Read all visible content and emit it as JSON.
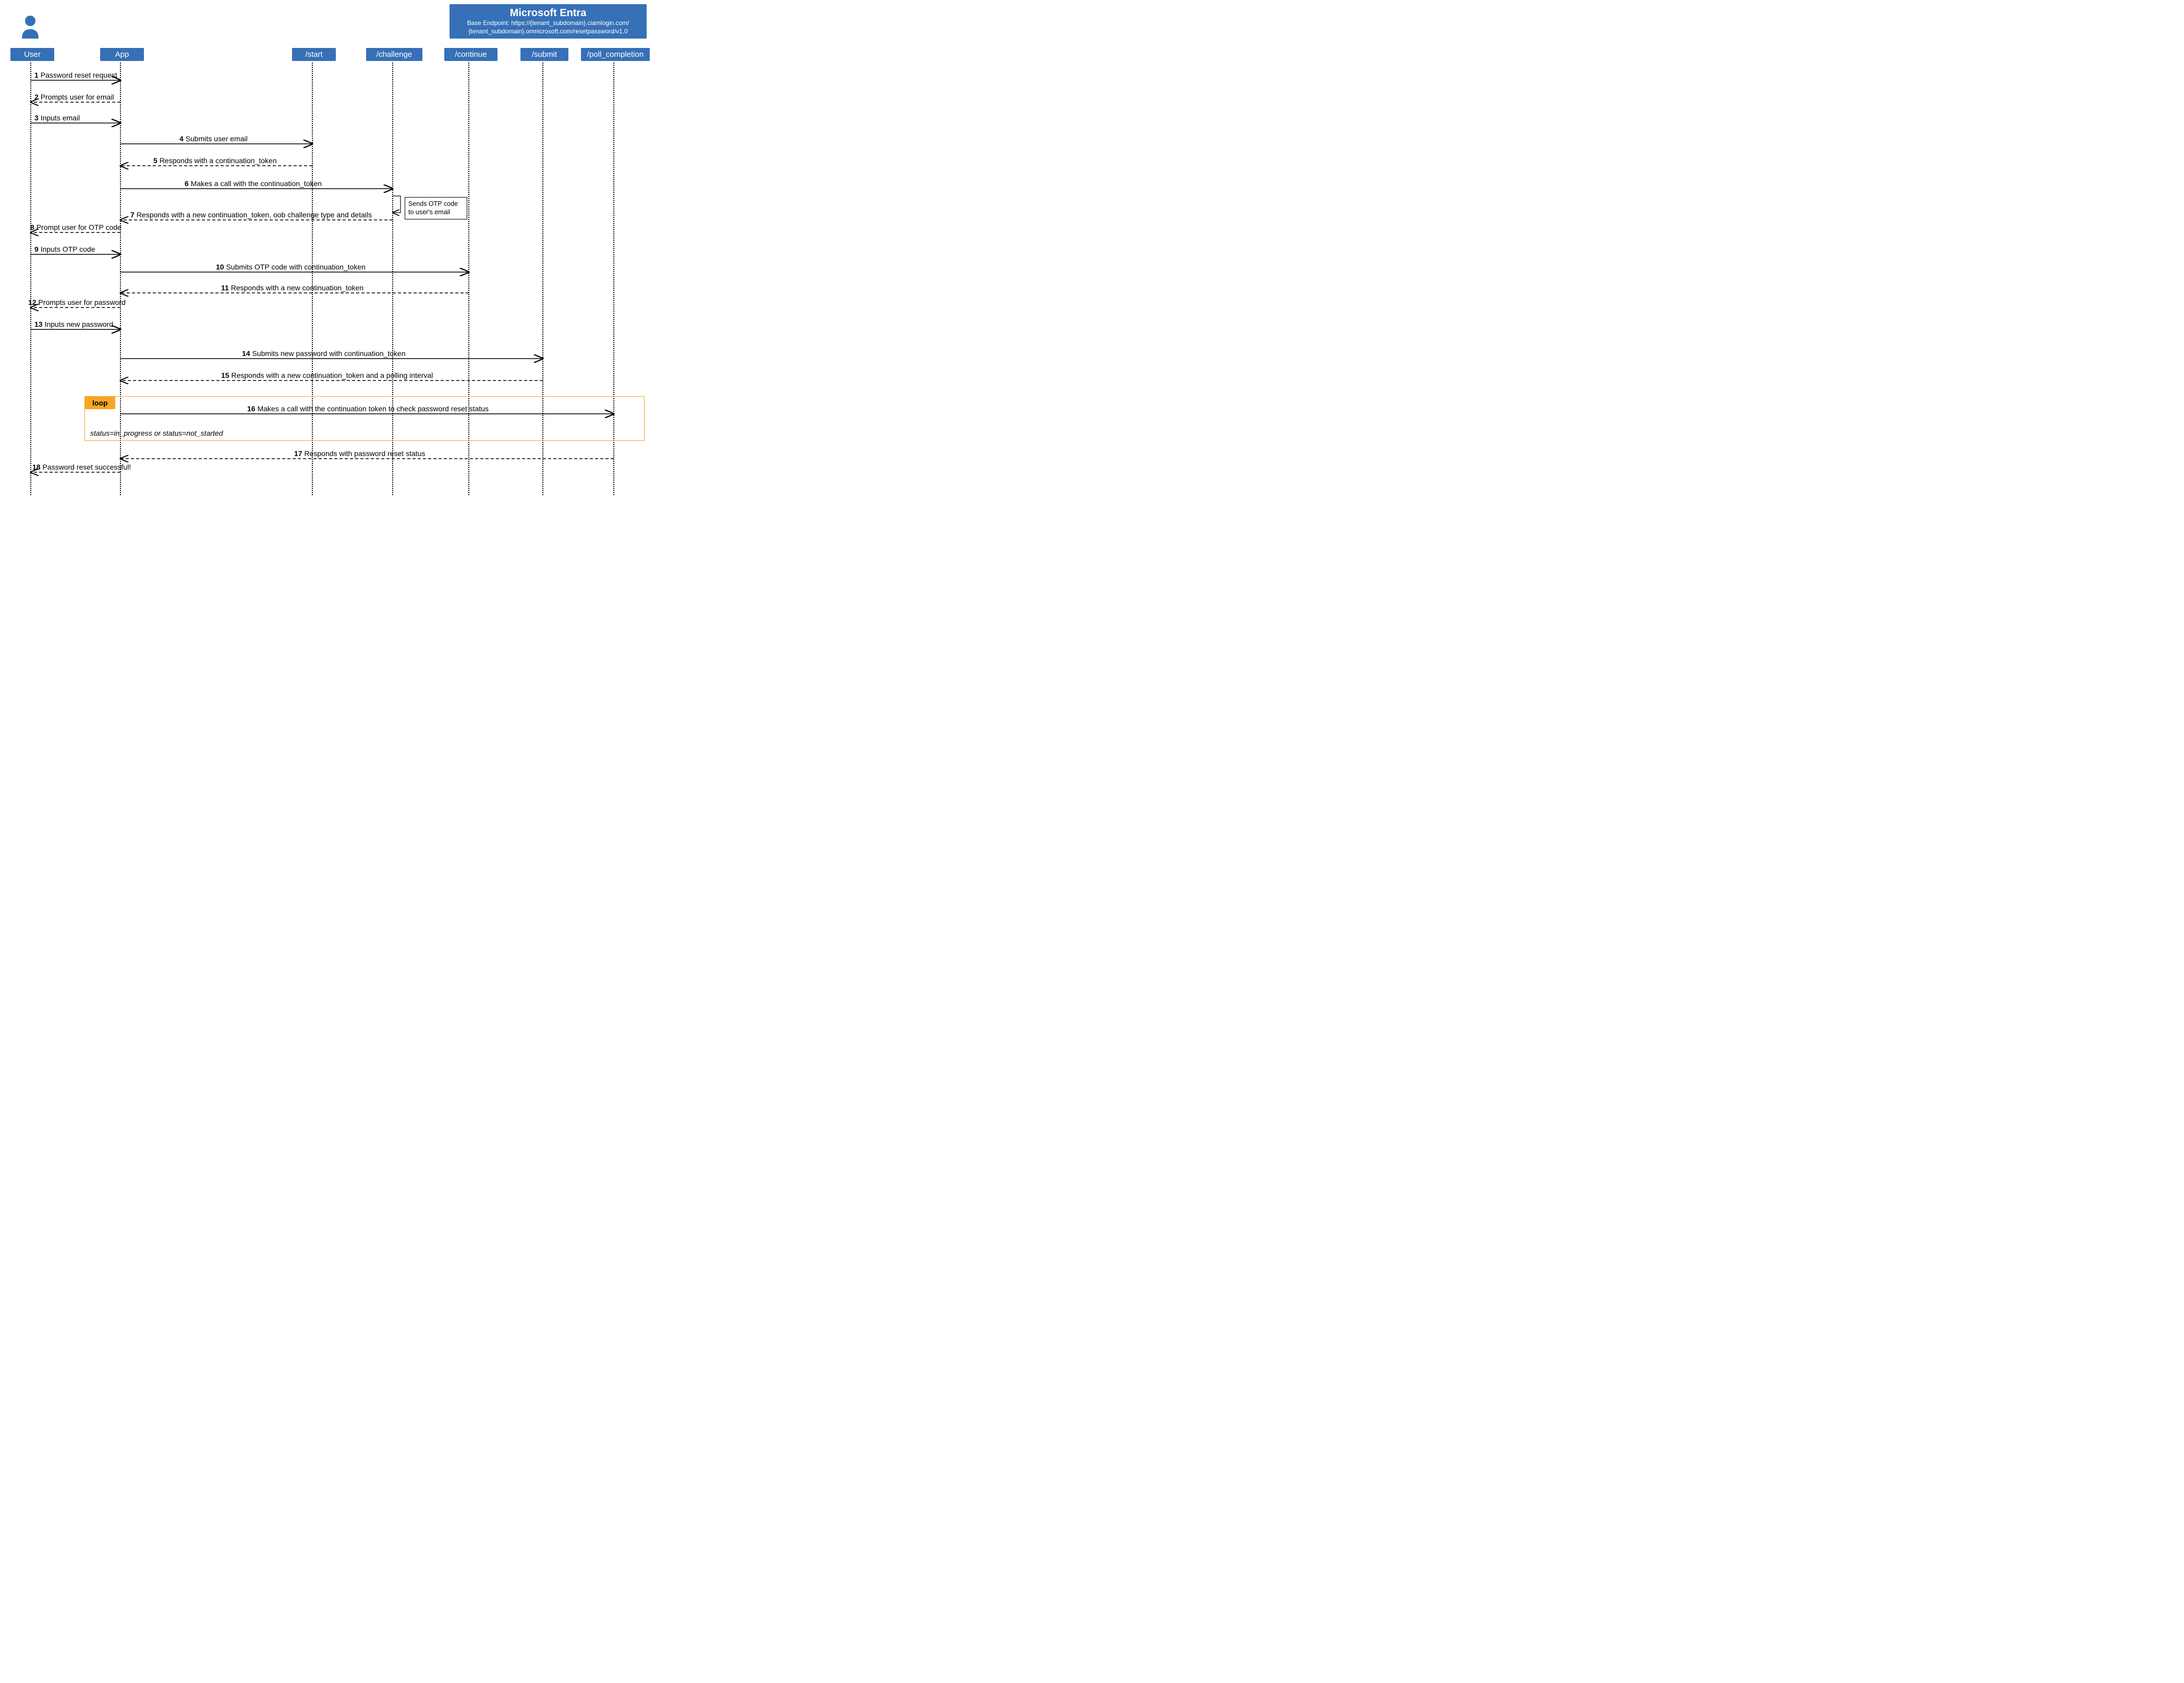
{
  "actor_label": "User",
  "header": {
    "title": "Microsoft Entra",
    "sub1": "Base Endpoint: https://{tenant_subdomain}.ciamlogin.com/",
    "sub2": "{tenant_subdomain}.onmicrosoft.com/resetpassword/v1.0"
  },
  "lanes": {
    "user": "User",
    "app": "App",
    "start": "/start",
    "challenge": "/challenge",
    "continue": "/continue",
    "submit": "/submit",
    "poll": "/poll_completion"
  },
  "note": {
    "l1": "Sends OTP code",
    "l2": "to user's email"
  },
  "loop": {
    "tag": "loop",
    "cond": "status=in_progress or status=not_started"
  },
  "msgs": {
    "m1": {
      "n": "1",
      "t": "Password reset request"
    },
    "m2": {
      "n": "2",
      "t": "Prompts user for email"
    },
    "m3": {
      "n": "3",
      "t": "Inputs email"
    },
    "m4": {
      "n": "4",
      "t": "Submits user email"
    },
    "m5": {
      "n": "5",
      "t": "Responds with a continuation_token"
    },
    "m6": {
      "n": "6",
      "t": "Makes a call with the continuation_token"
    },
    "m7": {
      "n": "7",
      "t": "Responds with a new continuation_token, oob challenge type and details"
    },
    "m8": {
      "n": "8",
      "t": "Prompt user for OTP code"
    },
    "m9": {
      "n": "9",
      "t": "Inputs OTP code"
    },
    "m10": {
      "n": "10",
      "t": "Submits OTP code with continuation_token"
    },
    "m11": {
      "n": "11",
      "t": "Responds with a new continuation_token"
    },
    "m12": {
      "n": "12",
      "t": "Prompts user for password"
    },
    "m13": {
      "n": "13",
      "t": "Inputs new password"
    },
    "m14": {
      "n": "14",
      "t": "Submits new password with continuation_token"
    },
    "m15": {
      "n": "15",
      "t": "Responds with a new continuation_token and a polling interval"
    },
    "m16": {
      "n": "16",
      "t": "Makes a call with the continuation token to check password reset status"
    },
    "m17": {
      "n": "17",
      "t": "Responds with password reset status"
    },
    "m18": {
      "n": "18",
      "t": "Password reset successful!"
    }
  }
}
